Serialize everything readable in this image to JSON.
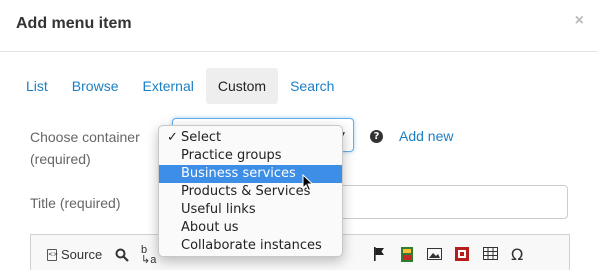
{
  "modal": {
    "title": "Add menu item",
    "close_glyph": "×"
  },
  "tabs": [
    {
      "label": "List"
    },
    {
      "label": "Browse"
    },
    {
      "label": "External"
    },
    {
      "label": "Custom",
      "active": true
    },
    {
      "label": "Search"
    }
  ],
  "form": {
    "container_label_line1": "Choose container",
    "container_label_line2": "(required)",
    "help_glyph": "?",
    "add_new": "Add new",
    "title_label": "Title (required)",
    "title_value": ""
  },
  "dropdown": {
    "selected_index": 0,
    "highlighted_index": 2,
    "options": [
      "Select",
      "Practice groups",
      "Business services",
      "Products & Services",
      "Useful links",
      "About us",
      "Collaborate instances"
    ]
  },
  "editor_toolbar": {
    "source_label": "Source",
    "icons": [
      "source-icon",
      "search-icon",
      "spellcheck-icon",
      "flag-icon",
      "image-green-icon",
      "image-icon",
      "media-icon",
      "table-icon",
      "omega-icon"
    ]
  },
  "colors": {
    "link": "#1b7fc4",
    "highlight": "#3d8ee6",
    "focus_border": "#66afe9"
  }
}
